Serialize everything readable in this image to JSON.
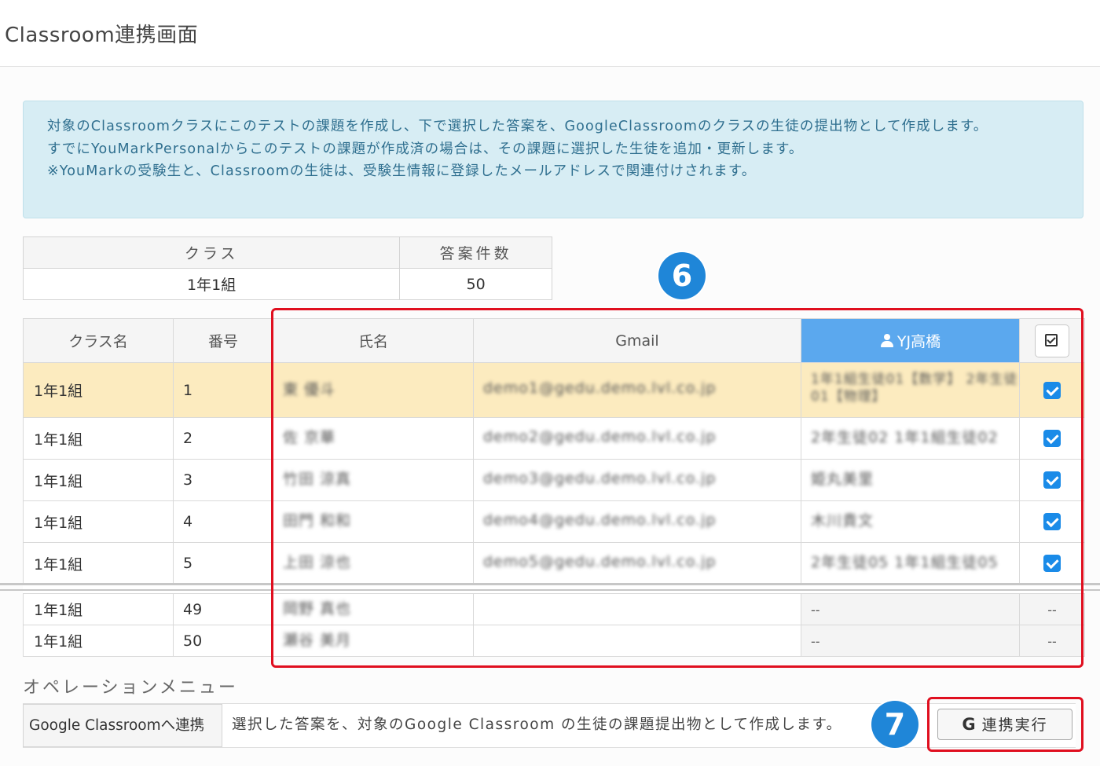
{
  "page": {
    "title": "Classroom連携画面"
  },
  "info": {
    "lines": [
      "対象のClassroomクラスにこのテストの課題を作成し、下で選択した答案を、GoogleClassroomのクラスの生徒の提出物として作成します。",
      "すでにYouMarkPersonalからこのテストの課題が作成済の場合は、その課題に選択した生徒を追加・更新します。",
      "※YouMarkの受験生と、Classroomの生徒は、受験生情報に登録したメールアドレスで関連付けされます。"
    ]
  },
  "summary": {
    "headers": {
      "class": "クラス",
      "count": "答案件数"
    },
    "class": "1年1組",
    "count": "50"
  },
  "students": {
    "headers": {
      "class_name": "クラス名",
      "number": "番号",
      "name": "氏名",
      "gmail": "Gmail",
      "yj_teacher": "YJ高橋"
    },
    "rows": [
      {
        "class_name": "1年1組",
        "number": "1",
        "name": "東 優斗",
        "gmail": "demo1@gedu.demo.lvl.co.jp",
        "yj": "1年1組生徒01【数学】 2年生徒01【物理】",
        "checked": true,
        "highlighted": true
      },
      {
        "class_name": "1年1組",
        "number": "2",
        "name": "佐 京華",
        "gmail": "demo2@gedu.demo.lvl.co.jp",
        "yj": "2年生徒02 1年1組生徒02",
        "checked": true
      },
      {
        "class_name": "1年1組",
        "number": "3",
        "name": "竹田 涼真",
        "gmail": "demo3@gedu.demo.lvl.co.jp",
        "yj": "姫丸美里",
        "checked": true
      },
      {
        "class_name": "1年1組",
        "number": "4",
        "name": "田門 和和",
        "gmail": "demo4@gedu.demo.lvl.co.jp",
        "yj": "木川貴文",
        "checked": true
      },
      {
        "class_name": "1年1組",
        "number": "5",
        "name": "上田 涼也",
        "gmail": "demo5@gedu.demo.lvl.co.jp",
        "yj": "2年生徒05 1年1組生徒05",
        "checked": true
      }
    ],
    "more_rows": [
      {
        "class_name": "1年1組",
        "number": "49",
        "name": "岡野 真也",
        "gmail": "",
        "yj": "--",
        "check": "--"
      },
      {
        "class_name": "1年1組",
        "number": "50",
        "name": "瀬谷 美月",
        "gmail": "",
        "yj": "--",
        "check": "--"
      }
    ]
  },
  "markers": {
    "six": "6",
    "seven": "7"
  },
  "operations": {
    "title": "オペレーションメニュー",
    "label": "Google Classroomへ連携",
    "description": "選択した答案を、対象のGoogle Classroom の生徒の課題提出物として作成します。",
    "button_icon": "G",
    "button_label": "連携実行"
  },
  "colors": {
    "accent_blue": "#1a8be8",
    "yj_header": "#5ba8ee",
    "highlight_row": "#fcebbf",
    "annotation_red": "#e00f1f",
    "info_bg": "#d7edf4"
  }
}
